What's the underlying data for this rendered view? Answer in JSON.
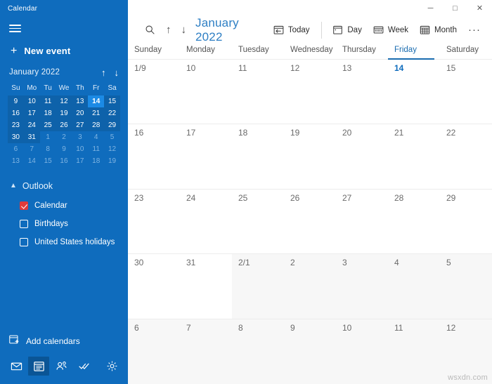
{
  "window": {
    "title": "Calendar",
    "controls": {
      "minimize": "─",
      "maximize": "□",
      "close": "✕"
    }
  },
  "sidebar": {
    "menu_icon": "hamburger-icon",
    "new_event": {
      "label": "New event",
      "icon": "plus-icon"
    },
    "mini_calendar": {
      "title": "January 2022",
      "prev_icon": "↑",
      "next_icon": "↓",
      "weekday_headers": [
        "Su",
        "Mo",
        "Tu",
        "We",
        "Th",
        "Fr",
        "Sa"
      ],
      "weeks": [
        [
          {
            "d": "9",
            "state": "in"
          },
          {
            "d": "10",
            "state": "in"
          },
          {
            "d": "11",
            "state": "in"
          },
          {
            "d": "12",
            "state": "in"
          },
          {
            "d": "13",
            "state": "in"
          },
          {
            "d": "14",
            "state": "today"
          },
          {
            "d": "15",
            "state": "in"
          }
        ],
        [
          {
            "d": "16",
            "state": "in"
          },
          {
            "d": "17",
            "state": "in"
          },
          {
            "d": "18",
            "state": "in"
          },
          {
            "d": "19",
            "state": "in"
          },
          {
            "d": "20",
            "state": "in"
          },
          {
            "d": "21",
            "state": "in"
          },
          {
            "d": "22",
            "state": "in"
          }
        ],
        [
          {
            "d": "23",
            "state": "in"
          },
          {
            "d": "24",
            "state": "in"
          },
          {
            "d": "25",
            "state": "in"
          },
          {
            "d": "26",
            "state": "in"
          },
          {
            "d": "27",
            "state": "in"
          },
          {
            "d": "28",
            "state": "in"
          },
          {
            "d": "29",
            "state": "in"
          }
        ],
        [
          {
            "d": "30",
            "state": "in"
          },
          {
            "d": "31",
            "state": "in"
          },
          {
            "d": "1",
            "state": "out"
          },
          {
            "d": "2",
            "state": "out"
          },
          {
            "d": "3",
            "state": "out"
          },
          {
            "d": "4",
            "state": "out"
          },
          {
            "d": "5",
            "state": "out"
          }
        ],
        [
          {
            "d": "6",
            "state": "out"
          },
          {
            "d": "7",
            "state": "out"
          },
          {
            "d": "8",
            "state": "out"
          },
          {
            "d": "9",
            "state": "out"
          },
          {
            "d": "10",
            "state": "out"
          },
          {
            "d": "11",
            "state": "out"
          },
          {
            "d": "12",
            "state": "out"
          }
        ],
        [
          {
            "d": "13",
            "state": "out"
          },
          {
            "d": "14",
            "state": "out"
          },
          {
            "d": "15",
            "state": "out"
          },
          {
            "d": "16",
            "state": "out"
          },
          {
            "d": "17",
            "state": "out"
          },
          {
            "d": "18",
            "state": "out"
          },
          {
            "d": "19",
            "state": "out"
          }
        ]
      ]
    },
    "account_group": {
      "name": "Outlook",
      "collapse_icon": "chevron-up-icon",
      "calendars": [
        {
          "label": "Calendar",
          "checked": true
        },
        {
          "label": "Birthdays",
          "checked": false
        },
        {
          "label": "United States holidays",
          "checked": false
        }
      ]
    },
    "add_calendars": {
      "label": "Add calendars",
      "icon": "add-calendar-icon"
    },
    "nav_buttons": [
      {
        "name": "mail-icon",
        "active": false
      },
      {
        "name": "calendar-icon",
        "active": true
      },
      {
        "name": "people-icon",
        "active": false
      },
      {
        "name": "todo-icon",
        "active": false
      },
      {
        "name": "settings-gear-icon",
        "active": false
      }
    ]
  },
  "toolbar": {
    "search_icon": "search-icon",
    "prev_label": "↑",
    "next_label": "↓",
    "month_title": "January 2022",
    "today_label": "Today",
    "day_label": "Day",
    "week_label": "Week",
    "month_label": "Month",
    "more_label": "···"
  },
  "calendar": {
    "weekday_headers": [
      {
        "label": "Sunday",
        "current": false
      },
      {
        "label": "Monday",
        "current": false
      },
      {
        "label": "Tuesday",
        "current": false
      },
      {
        "label": "Wednesday",
        "current": false
      },
      {
        "label": "Thursday",
        "current": false
      },
      {
        "label": "Friday",
        "current": true
      },
      {
        "label": "Saturday",
        "current": false
      }
    ],
    "weeks": [
      [
        {
          "label": "1/9",
          "other": false,
          "today": false
        },
        {
          "label": "10",
          "other": false,
          "today": false
        },
        {
          "label": "11",
          "other": false,
          "today": false
        },
        {
          "label": "12",
          "other": false,
          "today": false
        },
        {
          "label": "13",
          "other": false,
          "today": false
        },
        {
          "label": "14",
          "other": false,
          "today": true
        },
        {
          "label": "15",
          "other": false,
          "today": false
        }
      ],
      [
        {
          "label": "16",
          "other": false,
          "today": false
        },
        {
          "label": "17",
          "other": false,
          "today": false
        },
        {
          "label": "18",
          "other": false,
          "today": false
        },
        {
          "label": "19",
          "other": false,
          "today": false
        },
        {
          "label": "20",
          "other": false,
          "today": false
        },
        {
          "label": "21",
          "other": false,
          "today": false
        },
        {
          "label": "22",
          "other": false,
          "today": false
        }
      ],
      [
        {
          "label": "23",
          "other": false,
          "today": false
        },
        {
          "label": "24",
          "other": false,
          "today": false
        },
        {
          "label": "25",
          "other": false,
          "today": false
        },
        {
          "label": "26",
          "other": false,
          "today": false
        },
        {
          "label": "27",
          "other": false,
          "today": false
        },
        {
          "label": "28",
          "other": false,
          "today": false
        },
        {
          "label": "29",
          "other": false,
          "today": false
        }
      ],
      [
        {
          "label": "30",
          "other": false,
          "today": false
        },
        {
          "label": "31",
          "other": false,
          "today": false
        },
        {
          "label": "2/1",
          "other": true,
          "today": false
        },
        {
          "label": "2",
          "other": true,
          "today": false
        },
        {
          "label": "3",
          "other": true,
          "today": false
        },
        {
          "label": "4",
          "other": true,
          "today": false
        },
        {
          "label": "5",
          "other": true,
          "today": false
        }
      ],
      [
        {
          "label": "6",
          "other": true,
          "today": false
        },
        {
          "label": "7",
          "other": true,
          "today": false
        },
        {
          "label": "8",
          "other": true,
          "today": false
        },
        {
          "label": "9",
          "other": true,
          "today": false
        },
        {
          "label": "10",
          "other": true,
          "today": false
        },
        {
          "label": "11",
          "other": true,
          "today": false
        },
        {
          "label": "12",
          "other": true,
          "today": false
        }
      ]
    ]
  },
  "watermark": "wsxdn.com",
  "colors": {
    "sidebar_blue": "#0f6cbd",
    "today_blue": "#1b8ae5",
    "accent_link": "#2e7fc4",
    "checkbox_red": "#e03b3b",
    "other_month_bg": "#f7f7f7"
  }
}
